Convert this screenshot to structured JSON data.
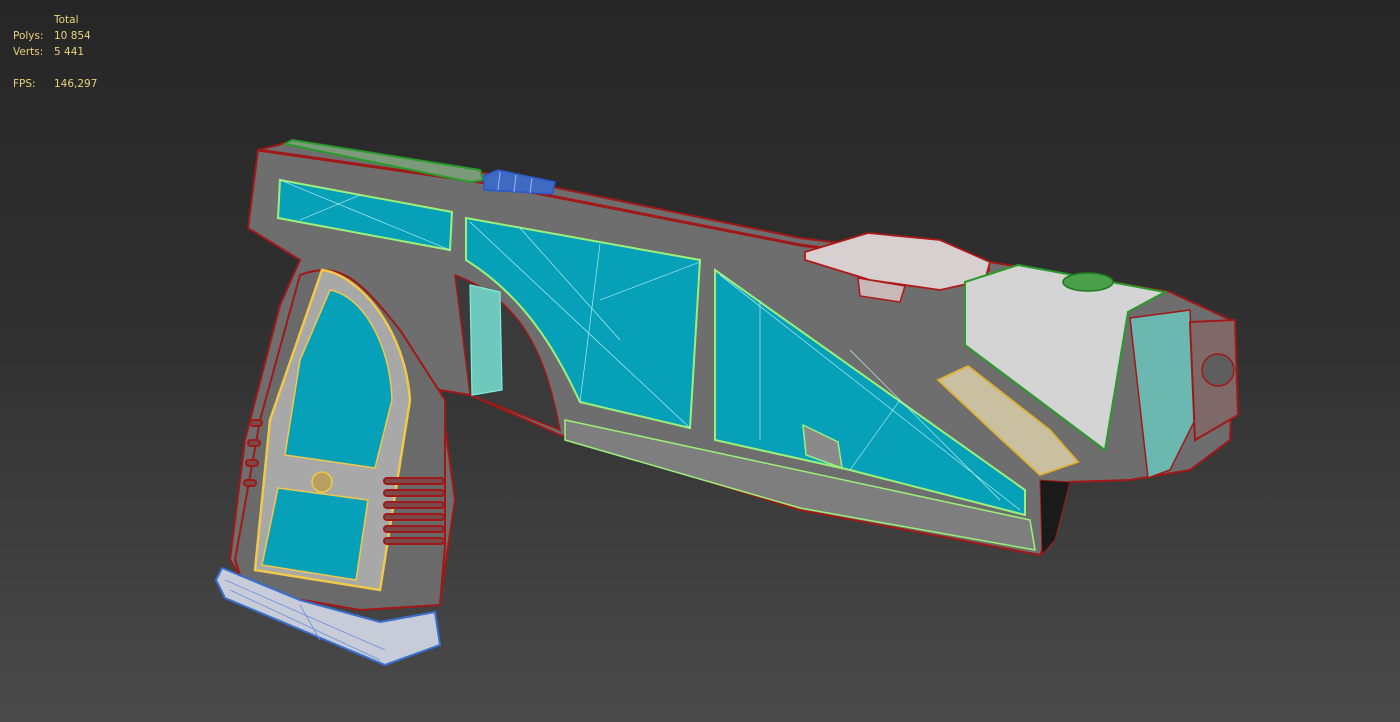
{
  "stats": {
    "header": "Total",
    "polys_label": "Polys:",
    "polys_value": "10 854",
    "verts_label": "Verts:",
    "verts_value": "5 441",
    "fps_label": "FPS:",
    "fps_value": "146,297"
  },
  "wire_colors": {
    "frame": "#a01818",
    "fill_gray": "#6e6e6e",
    "panel_cyan": "#06a0b8",
    "panel_edge": "#9cf07a",
    "grip_edge": "#f0c84a",
    "mag_blue": "#3a6fd0",
    "rail_green": "#2a9a2a",
    "block_white": "#d4d4d4"
  }
}
